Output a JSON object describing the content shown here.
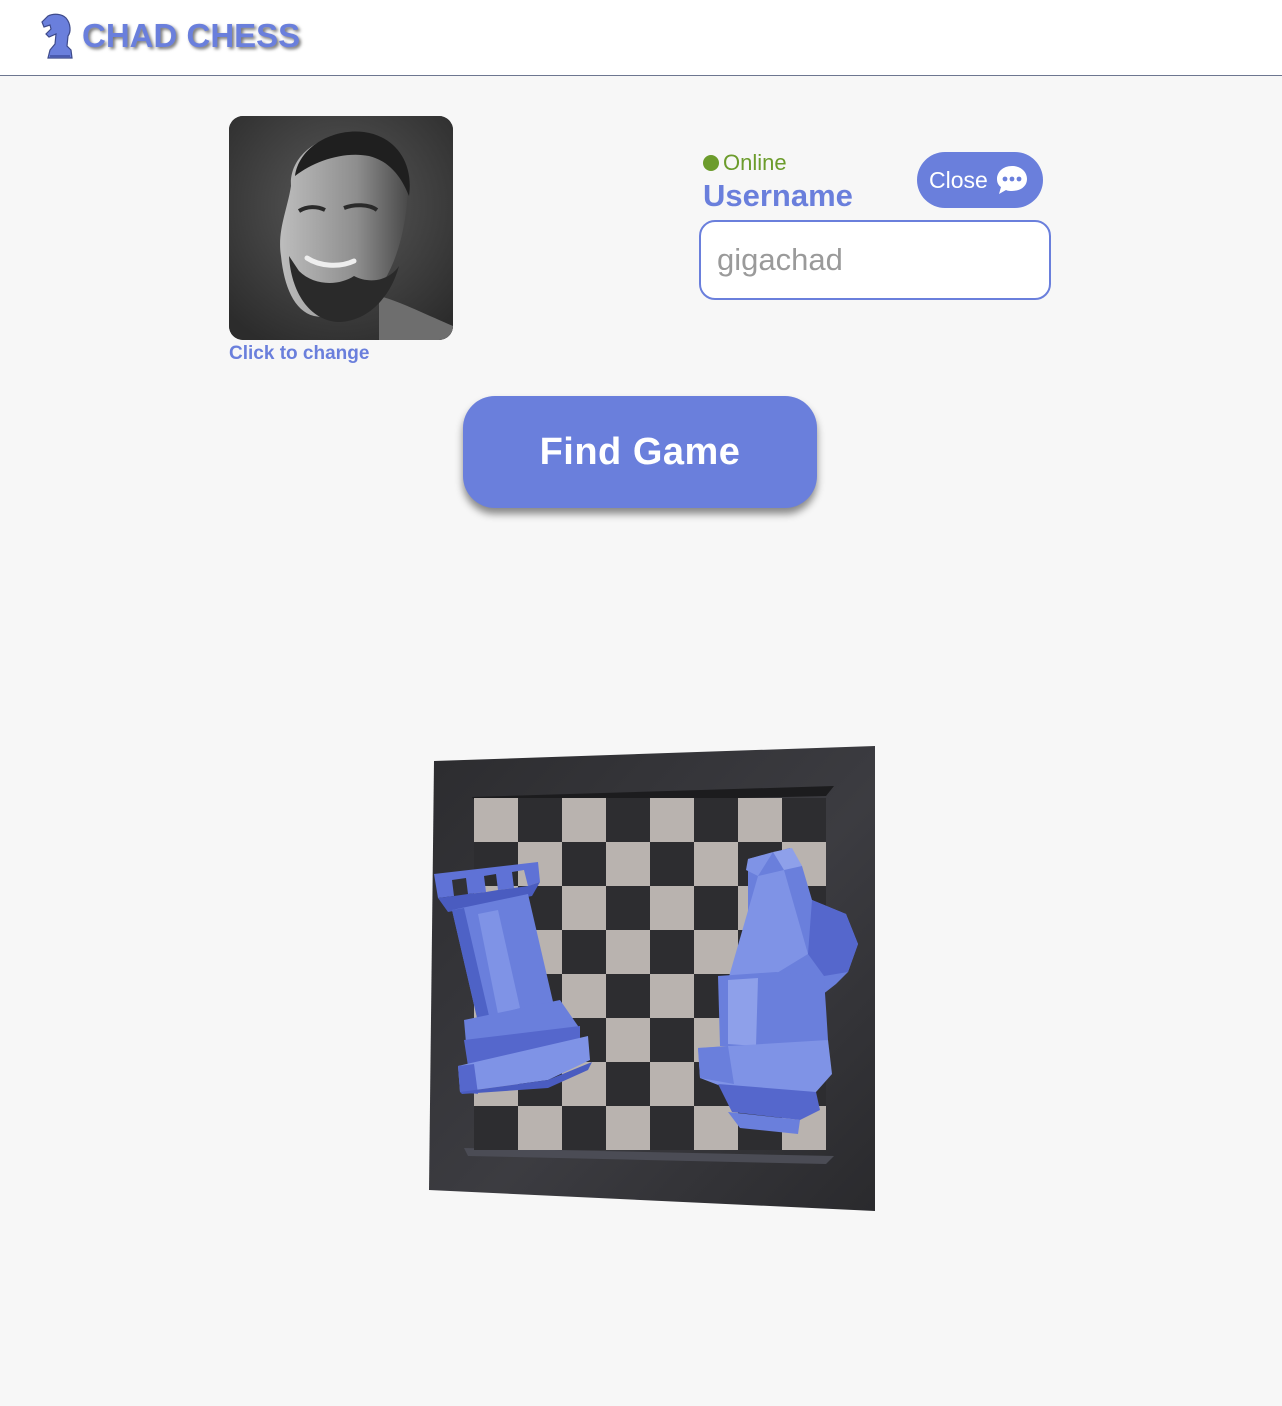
{
  "header": {
    "logo_text": "CHAD CHESS",
    "logo_icon": "knight-head-icon"
  },
  "profile": {
    "avatar_alt": "avatar",
    "change_label": "Click to change",
    "status_text": "Online",
    "username_label": "Username",
    "username_placeholder": "gigachad",
    "username_value": ""
  },
  "chat": {
    "close_label": "Close",
    "icon": "chat-bubble-icon"
  },
  "actions": {
    "find_game_label": "Find Game"
  },
  "illustration": {
    "icons": [
      "chess-board-icon",
      "rook-icon",
      "knight-icon"
    ]
  },
  "colors": {
    "accent": "#6a7fdc",
    "online": "#6c9c2c",
    "background": "#f7f7f7",
    "header_bg": "#ffffff"
  }
}
